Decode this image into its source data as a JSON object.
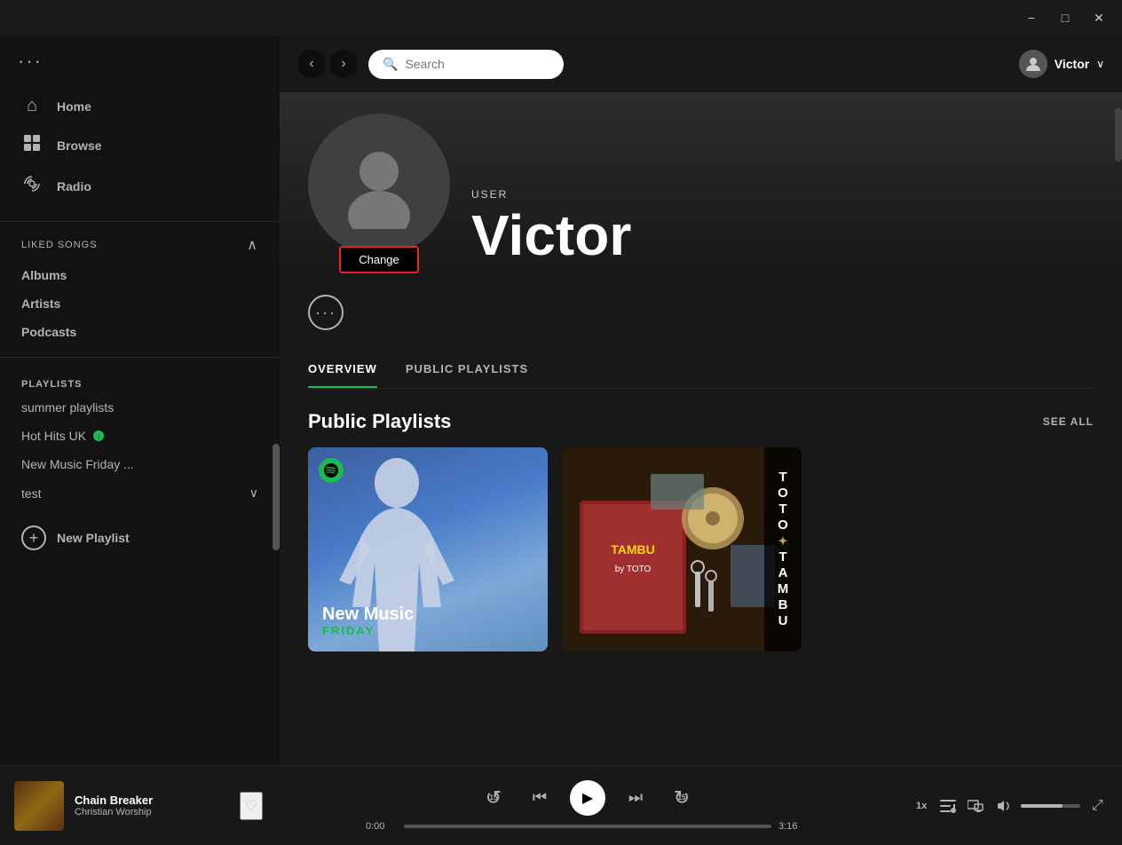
{
  "titlebar": {
    "minimize_label": "−",
    "maximize_label": "□",
    "close_label": "✕"
  },
  "sidebar": {
    "dots_label": "···",
    "nav_items": [
      {
        "id": "home",
        "label": "Home",
        "icon": "⌂"
      },
      {
        "id": "browse",
        "label": "Browse",
        "icon": "⊡"
      },
      {
        "id": "radio",
        "label": "Radio",
        "icon": "📡"
      }
    ],
    "library_sections": [
      {
        "id": "liked-songs",
        "label": "Liked Songs"
      },
      {
        "id": "albums",
        "label": "Albums"
      },
      {
        "id": "artists",
        "label": "Artists"
      },
      {
        "id": "podcasts",
        "label": "Podcasts"
      }
    ],
    "playlists_label": "PLAYLISTS",
    "playlists": [
      {
        "id": "summer-playlists",
        "label": "summer playlists",
        "has_download": false
      },
      {
        "id": "hot-hits-uk",
        "label": "Hot Hits UK",
        "has_download": true
      },
      {
        "id": "new-music-friday",
        "label": "New Music Friday ..."
      },
      {
        "id": "test",
        "label": "test",
        "has_chevron": true
      }
    ],
    "new_playlist_label": "New Playlist"
  },
  "topbar": {
    "back_label": "‹",
    "forward_label": "›",
    "search_placeholder": "Search",
    "user_name": "Victor",
    "chevron": "∨"
  },
  "profile": {
    "user_label": "USER",
    "name": "Victor",
    "change_btn_label": "Change",
    "more_btn_label": "···"
  },
  "tabs": [
    {
      "id": "overview",
      "label": "OVERVIEW",
      "active": true
    },
    {
      "id": "public-playlists",
      "label": "PUBLIC PLAYLISTS",
      "active": false
    }
  ],
  "public_playlists": {
    "title": "Public Playlists",
    "see_all_label": "SEE ALL",
    "cards": [
      {
        "id": "new-music-friday",
        "title": "New Music",
        "subtitle": "FRIDAY",
        "has_spotify_logo": true,
        "bg_type": "blue-gradient"
      },
      {
        "id": "toto-tambu",
        "title": "TOTO✦TAMBU",
        "has_spotify_logo": false,
        "bg_type": "dark-album"
      }
    ]
  },
  "player": {
    "album_thumb_alt": "Christian Worship album art",
    "track_name": "Chain Breaker",
    "track_artist": "Christian Worship",
    "is_liked": false,
    "skip_back_label": "15",
    "play_icon": "▶",
    "skip_forward_label": "15",
    "progress_current": "0:00",
    "progress_total": "3:16",
    "progress_pct": 0,
    "speed_label": "1x",
    "fullscreen_label": "⤢"
  }
}
